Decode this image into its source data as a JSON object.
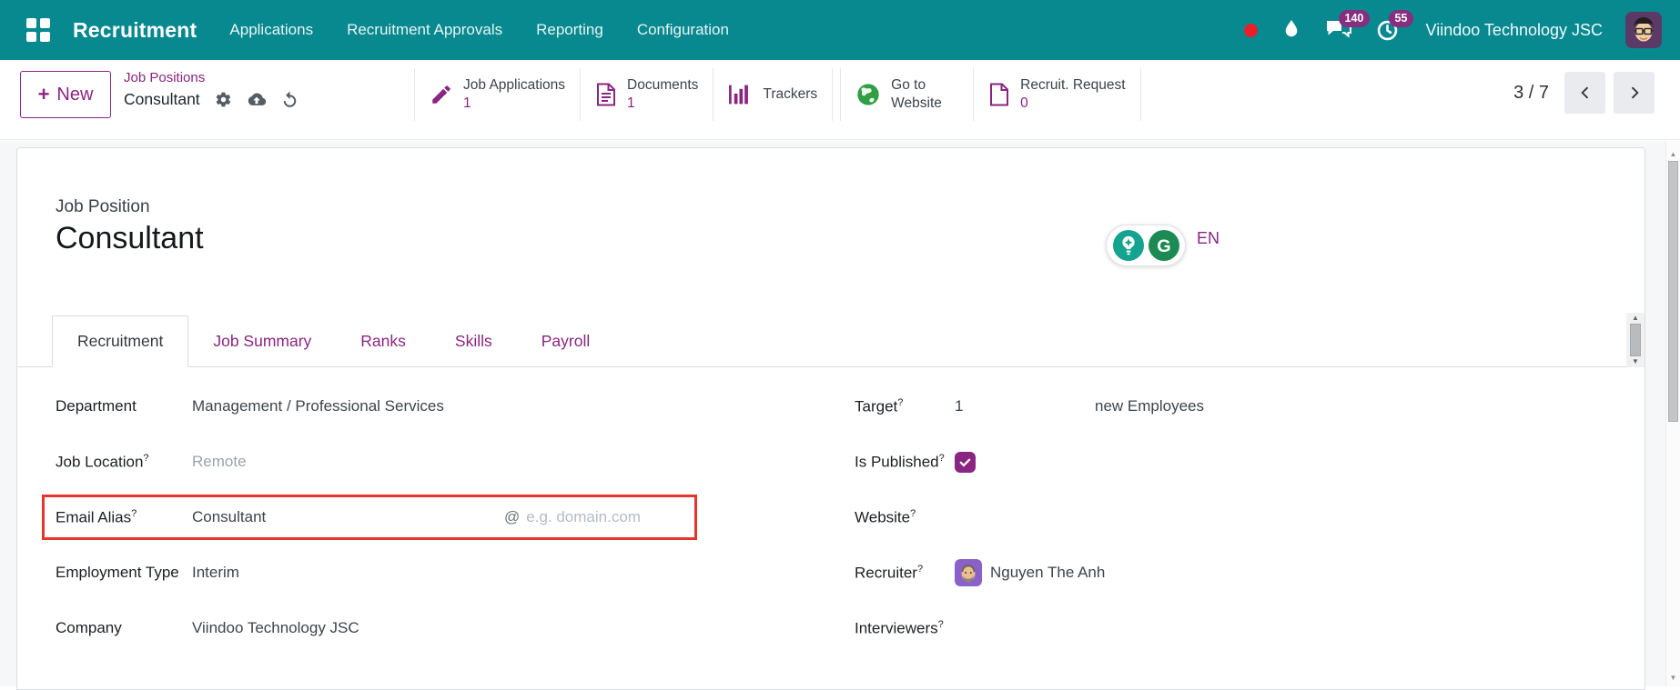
{
  "colors": {
    "topbar_bg": "#07898f",
    "accent_purple": "#8a2581",
    "badge_bg": "#862e80",
    "highlight_red": "#e7352b",
    "globe_green": "#2f9e44",
    "checkbox_purple": "#8a2581"
  },
  "topbar": {
    "brand": "Recruitment",
    "menus": [
      "Applications",
      "Recruitment Approvals",
      "Reporting",
      "Configuration"
    ],
    "messages_badge": "140",
    "activities_badge": "55",
    "company": "Viindoo Technology JSC"
  },
  "controlbar": {
    "new_label": "New",
    "new_plus": "+",
    "breadcrumb_parent": "Job Positions",
    "breadcrumb_current": "Consultant",
    "stat_buttons": [
      {
        "label": "Job Applications",
        "value": "1",
        "icon": "pencil-icon"
      },
      {
        "label": "Documents",
        "value": "1",
        "icon": "document-icon"
      },
      {
        "label": "Trackers",
        "value": "",
        "icon": "bar-chart-icon"
      },
      {
        "label": "Go to Website",
        "value": "",
        "icon": "globe-icon"
      },
      {
        "label": "Recruit. Request",
        "value": "0",
        "icon": "file-icon"
      }
    ],
    "pager": "3 / 7"
  },
  "sheet": {
    "record_label": "Job Position",
    "record_name": "Consultant",
    "language": "EN",
    "help_marker": "?",
    "tabs": [
      {
        "label": "Recruitment"
      },
      {
        "label": "Job Summary"
      },
      {
        "label": "Ranks"
      },
      {
        "label": "Skills"
      },
      {
        "label": "Payroll"
      }
    ],
    "fields_left": [
      {
        "label": "Department",
        "value": "Management / Professional Services"
      },
      {
        "label": "Job Location",
        "value": "Remote"
      },
      {
        "label": "Email Alias",
        "value": "Consultant",
        "at": "@",
        "placeholder": "e.g. domain.com"
      },
      {
        "label": "Employment Type",
        "value": "Interim"
      },
      {
        "label": "Company",
        "value": "Viindoo Technology JSC"
      }
    ],
    "fields_right": [
      {
        "label": "Target",
        "value": "1",
        "suffix": "new Employees"
      },
      {
        "label": "Is Published",
        "checked": true
      },
      {
        "label": "Website",
        "value": ""
      },
      {
        "label": "Recruiter",
        "value": "Nguyen The Anh"
      },
      {
        "label": "Interviewers",
        "value": ""
      }
    ]
  },
  "icons": {
    "apps": "grid-2x2",
    "recording_indicator": "red-dot",
    "droplet": "water-drop",
    "messages": "chat-bubbles",
    "activities": "clock",
    "settings": "gear",
    "save": "cloud-upload",
    "discard": "undo-arrow",
    "job_applications": "pencil",
    "documents": "document-lines",
    "trackers": "bar-chart",
    "go_to_website": "globe",
    "recruit_request": "file",
    "pager_prev": "chevron-left",
    "pager_next": "chevron-right",
    "assistant": "lightbulb-sparkle",
    "grammarly": "g-logo",
    "is_published": "checkmark"
  }
}
